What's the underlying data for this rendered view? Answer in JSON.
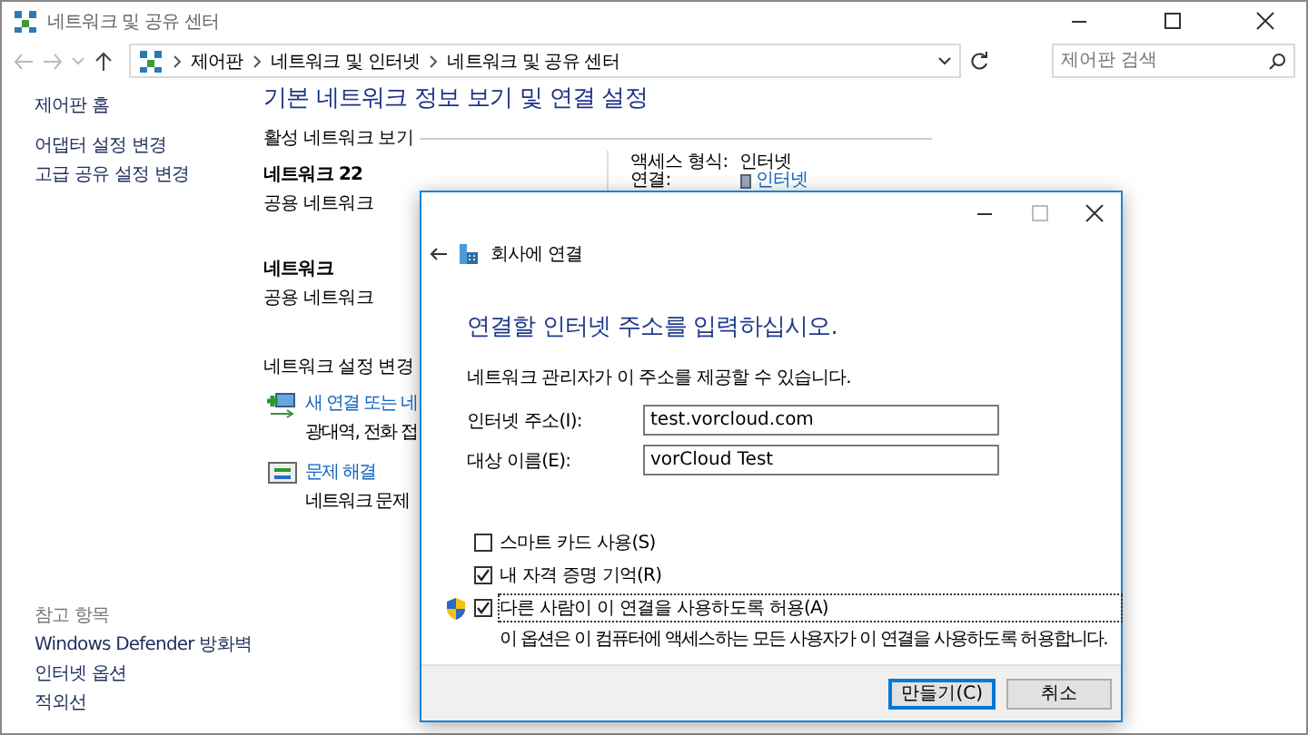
{
  "window": {
    "title": "네트워크 및 공유 센터"
  },
  "address_bar": {
    "breadcrumbs": [
      "제어판",
      "네트워크 및 인터넷",
      "네트워크 및 공유 센터"
    ]
  },
  "search": {
    "placeholder": "제어판 검색"
  },
  "sidebar": {
    "items": [
      "제어판 홈",
      "어댑터 설정 변경",
      "고급 공유 설정 변경"
    ],
    "see_also_title": "참고 항목",
    "see_also": [
      "Windows Defender 방화벽",
      "인터넷 옵션",
      "적외선"
    ]
  },
  "main": {
    "heading": "기본 네트워크 정보 보기 및 연결 설정",
    "active_title": "활성 네트워크 보기",
    "networks": [
      {
        "name": "네트워크 22",
        "type": "공용 네트워크",
        "access_label": "액세스 형식:",
        "access_value": "인터넷",
        "connection_label": "연결:",
        "connection_value": "인터넷"
      },
      {
        "name": "네트워크",
        "type": "공용 네트워크"
      }
    ],
    "settings_title": "네트워크 설정 변경",
    "tasks": [
      {
        "kind": "new",
        "link": "새 연결 또는 네",
        "description": "광대역, 전화 접"
      },
      {
        "kind": "troubleshoot",
        "link": "문제 해결",
        "description": "네트워크 문제"
      }
    ]
  },
  "dialog": {
    "title": "회사에 연결",
    "heading": "연결할 인터넷 주소를 입력하십시오.",
    "description": "네트워크 관리자가 이 주소를 제공할 수 있습니다.",
    "fields": [
      {
        "label": "인터넷 주소(I):",
        "value": "test.vorcloud.com"
      },
      {
        "label": "대상 이름(E):",
        "value": "vorCloud Test"
      }
    ],
    "options": [
      {
        "label": "스마트 카드 사용(S)",
        "checked": false,
        "admin": false
      },
      {
        "label": "내 자격 증명 기억(R)",
        "checked": true,
        "admin": false
      },
      {
        "label": "다른 사람이 이 연결을 사용하도록 허용(A)",
        "checked": true,
        "admin": true,
        "focused": true,
        "note": "이 옵션은 이 컴퓨터에 액세스하는 모든 사용자가 이 연결을 사용하도록 허용합니다."
      }
    ],
    "buttons": [
      {
        "label": "만들기(C)",
        "default": true
      },
      {
        "label": "취소",
        "default": false
      }
    ]
  }
}
